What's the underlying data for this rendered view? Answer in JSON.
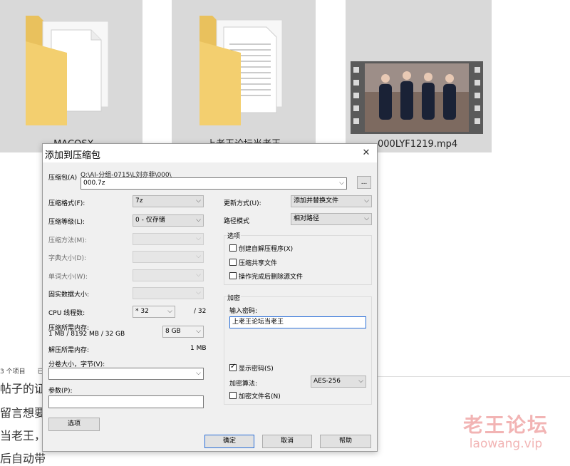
{
  "explorer": {
    "folder1_label": "_MACOSX",
    "folder2_label": "上老王论坛当老王",
    "video_label": "000LYF1219.mp4",
    "status_items": "3 个项目",
    "status_selected": "已",
    "blog_lines": [
      "帖子的证",
      "留言想要",
      "当老王，",
      "后自动带"
    ],
    "watermark_title": "老王论坛",
    "watermark_sub": "laowang.vip"
  },
  "dialog": {
    "title": "添加到压缩包",
    "close_icon": "✕",
    "archive_label": "压缩包(A)",
    "archive_path": "Q:\\AI-分组-0715\\L刘亦菲\\000\\",
    "archive_name": "000.7z",
    "browse_label": "...",
    "left": {
      "format_label": "压缩格式(F):",
      "format_value": "7z",
      "level_label": "压缩等级(L):",
      "level_value": "0 - 仅存储",
      "method_label": "压缩方法(M):",
      "dict_label": "字典大小(D):",
      "word_label": "单词大小(W):",
      "solid_label": "固实数据大小:",
      "threads_label": "CPU 线程数:",
      "threads_value": "* 32",
      "threads_max": "/ 32",
      "mem_comp_label": "压缩所需内存:",
      "mem_comp_detail": "1 MB / 8192 MB / 32 GB",
      "mem_limit_value": "8 GB",
      "mem_decomp_label": "解压所需内存:",
      "mem_decomp_value": "1 MB",
      "split_label": "分卷大小，字节(V):",
      "params_label": "参数(P):",
      "options_button": "选项"
    },
    "right": {
      "update_label": "更新方式(U):",
      "update_value": "添加并替换文件",
      "path_mode_label": "路径模式",
      "path_mode_value": "相对路径",
      "options_group": "选项",
      "opt_sfx": "创建自解压程序(X)",
      "opt_shared": "压缩共享文件",
      "opt_delete": "操作完成后删除源文件",
      "enc_group": "加密",
      "pwd_label": "输入密码:",
      "pwd_value": "上老王论坛当老王",
      "show_pwd": "显示密码(S)",
      "show_pwd_checked": true,
      "enc_method_label": "加密算法:",
      "enc_method_value": "AES-256",
      "enc_names": "加密文件名(N)"
    },
    "buttons": {
      "ok": "确定",
      "cancel": "取消",
      "help": "帮助"
    }
  },
  "colors": {
    "accent_border": "#2a6fd8",
    "dialog_bg": "#f0f0f0",
    "tile_bg": "#d9d9d9",
    "watermark": "#f2b4b4"
  }
}
